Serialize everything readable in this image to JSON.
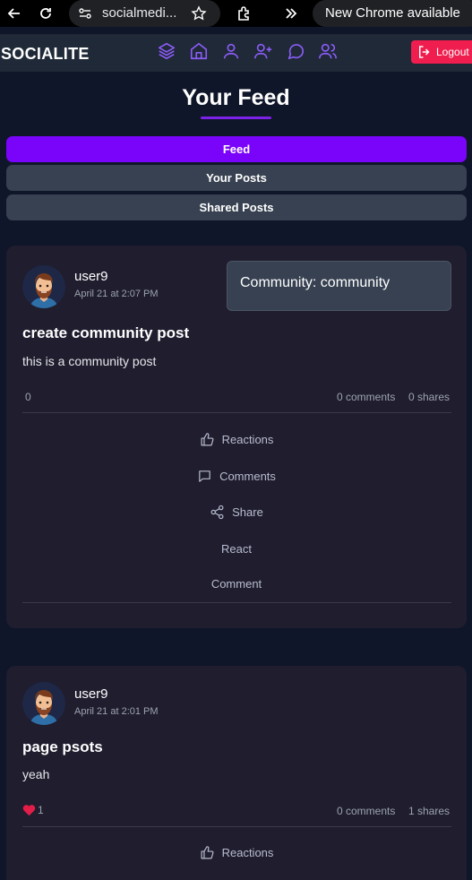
{
  "browser": {
    "url": "socialmedi...",
    "update_notice": "New Chrome available"
  },
  "nav": {
    "brand": "SOCIALITE",
    "icons": [
      "layers-icon",
      "home-icon",
      "user-icon",
      "user-plus-icon",
      "chat-icon",
      "users-icon"
    ],
    "logout_label": "Logout",
    "icon_color": "#8b5cf6"
  },
  "page": {
    "title": "Your Feed",
    "accent": "#7a04f9"
  },
  "tabs": [
    {
      "label": "Feed",
      "active": true
    },
    {
      "label": "Your Posts",
      "active": false
    },
    {
      "label": "Shared Posts",
      "active": false
    }
  ],
  "posts": [
    {
      "username": "user9",
      "date": "April 21 at 2:07 PM",
      "community": "Community: community",
      "title": "create community post",
      "body": "this is a community post",
      "reactions_count": "0",
      "comments": "0 comments",
      "shares": "0 shares",
      "actions": {
        "reactions": "Reactions",
        "comments": "Comments",
        "share": "Share",
        "react": "React",
        "comment": "Comment"
      }
    },
    {
      "username": "user9",
      "date": "April 21 at 2:01 PM",
      "title": "page psots",
      "body": "yeah",
      "reactions_count": "1",
      "comments": "0 comments",
      "shares": "1 shares",
      "actions": {
        "reactions": "Reactions"
      }
    }
  ]
}
